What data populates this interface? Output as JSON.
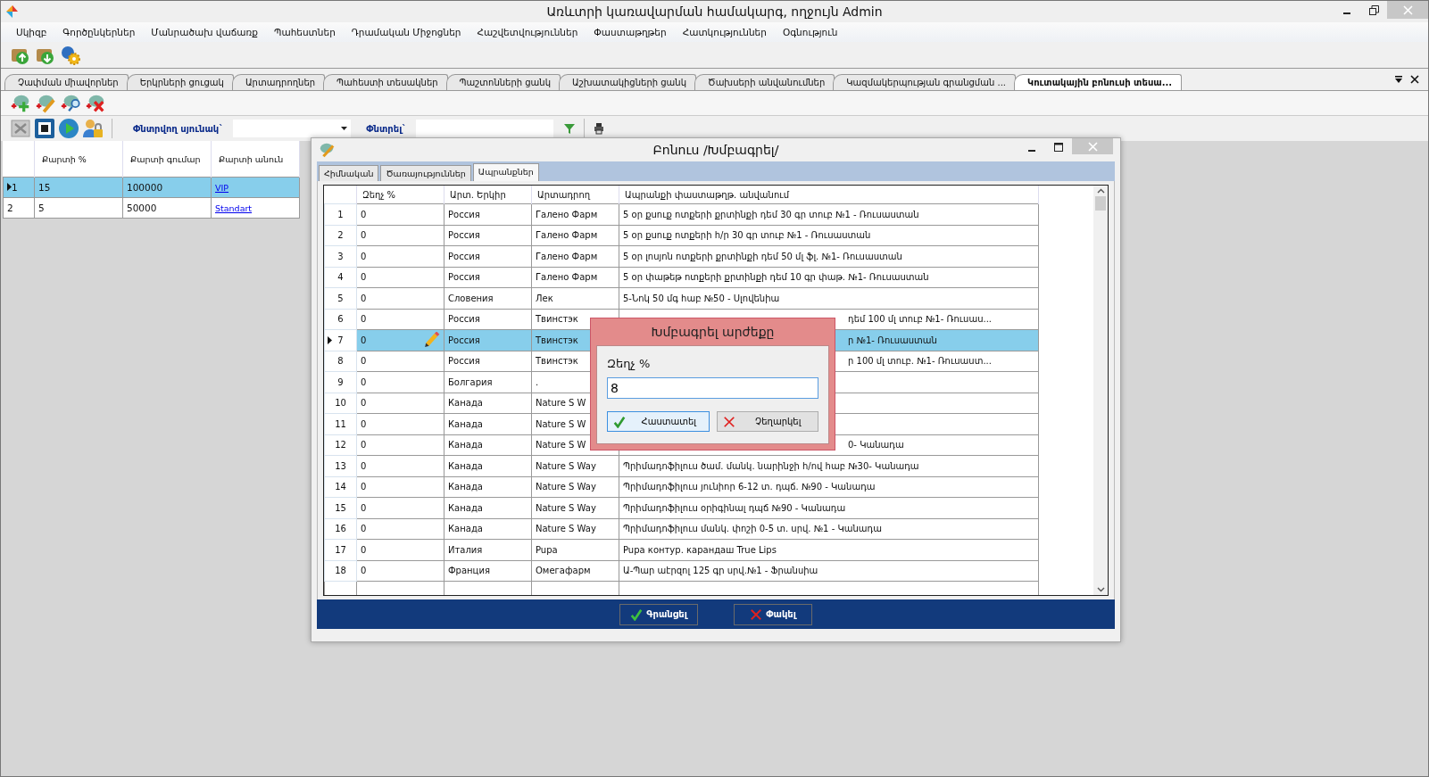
{
  "window": {
    "title": "Առևտրի կառավարման համակարգ, ողջույն Admin"
  },
  "menu": [
    "Սկիզբ",
    "Գործընկերներ",
    "Մանրածախ վաճառք",
    "Պահեստներ",
    "Դրամական Միջոցներ",
    "Հաշվետվություններ",
    "Փաստաթղթեր",
    "Հատկություններ",
    "Օգնություն"
  ],
  "tabs": [
    {
      "label": "Չափման միավորներ",
      "selected": false
    },
    {
      "label": "Երկրների ցուցակ",
      "selected": false
    },
    {
      "label": "Արտադրողներ",
      "selected": false
    },
    {
      "label": "Պահեստի տեսակներ",
      "selected": false
    },
    {
      "label": "Պաշտոնների ցանկ",
      "selected": false
    },
    {
      "label": "Աշխատակիցների ցանկ",
      "selected": false
    },
    {
      "label": "Ծախսերի անվանումներ",
      "selected": false
    },
    {
      "label": "Կազմակերպության գրանցման ...",
      "selected": false
    },
    {
      "label": "Կուտակային բոնուսի տեսա...",
      "selected": true
    }
  ],
  "filter": {
    "column_label": "Փնտրվող սյունակ`",
    "search_label": "Փնտրել`"
  },
  "cards_table": {
    "columns": [
      "Քարտի %",
      "Քարտի գումար",
      "Քարտի անուն"
    ],
    "rows": [
      {
        "number": "1",
        "selected": true,
        "percent": "15",
        "amount": "100000",
        "name": "VIP"
      },
      {
        "number": "2",
        "selected": false,
        "percent": "5",
        "amount": "50000",
        "name": "Standart"
      }
    ]
  },
  "dialog": {
    "title": "Բոնուս /Խմբագրել/",
    "tabs": [
      {
        "label": "Հիմնական",
        "selected": false
      },
      {
        "label": "Ծառայություններ",
        "selected": false
      },
      {
        "label": "Ապրանքներ",
        "selected": true
      }
    ],
    "columns": [
      "Զեղչ %",
      "Արտ. Երկիր",
      "Արտադրող",
      "Ապրանքի փաստաթղթ. անվանում"
    ],
    "rows": [
      {
        "number": "1",
        "selected": false,
        "discount": "0",
        "country": "Россия",
        "maker": "Галено Фарм",
        "product": "5 օր քսուք ոտքերի քրտինքի դեմ 30 գր տուբ №1 - Ռուսաստան"
      },
      {
        "number": "2",
        "selected": false,
        "discount": "0",
        "country": "Россия",
        "maker": "Галено Фарм",
        "product": "5 օր քսուք ոտքերի հ/ր 30 գր տուբ №1 - Ռուսաստան"
      },
      {
        "number": "3",
        "selected": false,
        "discount": "0",
        "country": "Россия",
        "maker": "Галено Фарм",
        "product": "5 օր լոսյոն ոտքերի քրտինքի դեմ 50 մլ ֆլ. №1- Ռուսաստան"
      },
      {
        "number": "4",
        "selected": false,
        "discount": "0",
        "country": "Россия",
        "maker": "Галено Фарм",
        "product": "5 օր փաթեթ ոտքերի քրտինքի դեմ 10 գր փաթ. №1- Ռուսաստան"
      },
      {
        "number": "5",
        "selected": false,
        "discount": "0",
        "country": "Словения",
        "maker": "Лек",
        "product": "5-Նոկ 50 մգ հաբ №50 - Սլովենիա"
      },
      {
        "number": "6",
        "selected": false,
        "discount": "0",
        "country": "Россия",
        "maker": "Твинстэк",
        "product": "դեմ 100 մլ տուբ №1- Ռուսաս...",
        "covered": true
      },
      {
        "number": "7",
        "selected": true,
        "discount": "0",
        "country": "Россия",
        "maker": "Твинстэк",
        "product": "ր №1- Ռուսաստան",
        "covered": true
      },
      {
        "number": "8",
        "selected": false,
        "discount": "0",
        "country": "Россия",
        "maker": "Твинстэк",
        "product": "ր 100 մլ տուբ. №1- Ռուսաստ...",
        "covered": true
      },
      {
        "number": "9",
        "selected": false,
        "discount": "0",
        "country": "Болгария",
        "maker": "."
      },
      {
        "number": "10",
        "selected": false,
        "discount": "0",
        "country": "Канада",
        "maker": "Nature S W"
      },
      {
        "number": "11",
        "selected": false,
        "discount": "0",
        "country": "Канада",
        "maker": "Nature S W"
      },
      {
        "number": "12",
        "selected": false,
        "discount": "0",
        "country": "Канада",
        "maker": "Nature S W",
        "product": "0- Կանադա",
        "covered": true
      },
      {
        "number": "13",
        "selected": false,
        "discount": "0",
        "country": "Канада",
        "maker": "Nature S Way",
        "product": "Պրիմադոֆիլուս ծամ. մանկ. նարինջի  հ/ով հաբ №30- Կանադա"
      },
      {
        "number": "14",
        "selected": false,
        "discount": "0",
        "country": "Канада",
        "maker": "Nature S Way",
        "product": "Պրիմադոֆիլուս յունիոր 6-12 տ. դպճ. №90 - Կանադա"
      },
      {
        "number": "15",
        "selected": false,
        "discount": "0",
        "country": "Канада",
        "maker": "Nature S Way",
        "product": "Պրիմադոֆիլուս օրիգինալ դպճ №90 - Կանադա"
      },
      {
        "number": "16",
        "selected": false,
        "discount": "0",
        "country": "Канада",
        "maker": "Nature S Way",
        "product": "Պրիմադոֆիլուս մանկ. փոշի 0-5 տ. սրվ. №1 - Կանադա"
      },
      {
        "number": "17",
        "selected": false,
        "discount": "0",
        "country": "Италия",
        "maker": "Pupa",
        "product": "Pupa контур. карандаш True Lips"
      },
      {
        "number": "18",
        "selected": false,
        "discount": "0",
        "country": "Франция",
        "maker": "Омегафарм",
        "product": "Ա-Պար աէրզոլ 125 գր սրվ.№1 - Ֆրանսիա"
      }
    ],
    "buttons": [
      {
        "label": "Գրանցել",
        "kind": "ok"
      },
      {
        "label": "Փակել",
        "kind": "cancel"
      }
    ]
  },
  "popup": {
    "title": "Խմբագրել արժեքը",
    "label": "Զեղչ %",
    "value": "8",
    "buttons": [
      {
        "label": "Հաստատել",
        "kind": "ok",
        "focused": true
      },
      {
        "label": "Չեղարկել",
        "kind": "cancel",
        "focused": false
      }
    ]
  }
}
